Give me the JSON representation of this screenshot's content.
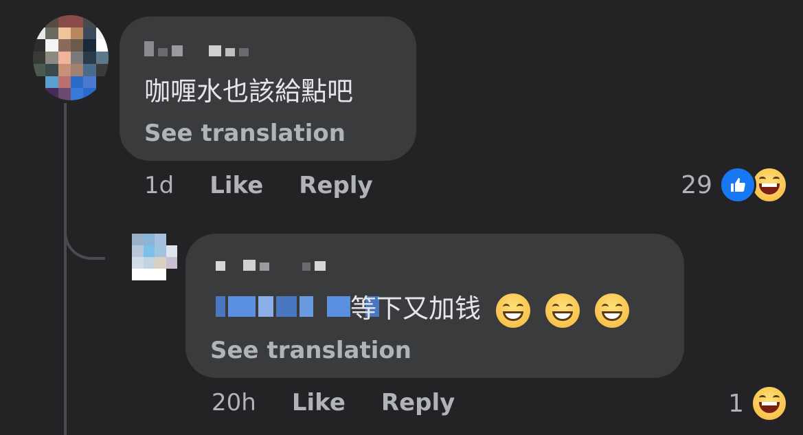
{
  "comments": [
    {
      "text": "咖喱水也該給點吧",
      "see_translation": "See translation",
      "time": "1d",
      "like_label": "Like",
      "reply_label": "Reply",
      "reaction_count": "29",
      "reactions": [
        "like-icon",
        "haha-icon"
      ]
    },
    {
      "text": "等下又加钱",
      "emojis": [
        "grinning-face-icon",
        "grinning-face-icon",
        "grinning-face-icon"
      ],
      "see_translation": "See translation",
      "time": "20h",
      "like_label": "Like",
      "reply_label": "Reply",
      "reaction_count": "1",
      "reactions": [
        "haha-icon"
      ]
    }
  ],
  "colors": {
    "background": "#232325",
    "bubble": "#3a3b3d",
    "secondary_text": "#b0b3b8",
    "primary_text": "#e4e6eb",
    "like_blue": "#1877f2",
    "mention_blue": "#5b8fe0"
  }
}
